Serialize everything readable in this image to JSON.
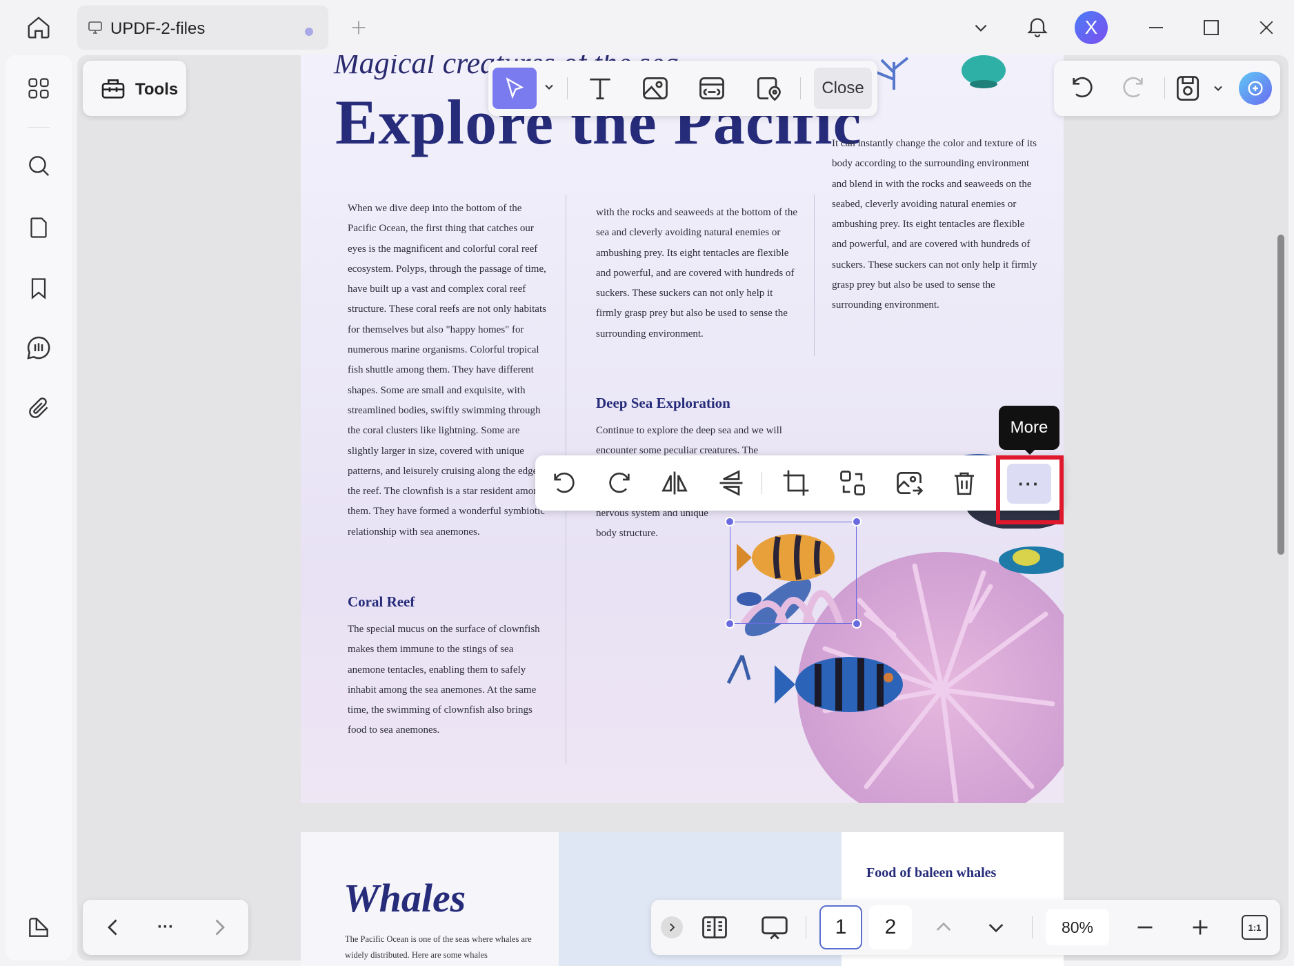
{
  "tab": {
    "title": "UPDF-2-files"
  },
  "user": {
    "avatar_initial": "X"
  },
  "tools": {
    "label": "Tools"
  },
  "edit_toolbar": {
    "close_label": "Close"
  },
  "page": {
    "subtitle": "Magical creatures of the sea",
    "title": "Explore the Pacific",
    "col1_para1": "When we dive deep into the bottom of the Pacific Ocean, the first thing that catches our eyes is the magnificent and colorful coral reef ecosystem. Polyps, through the passage of time, have built up a vast and complex coral reef structure. These coral reefs are not only habitats for themselves but also \"happy homes\" for numerous marine organisms. Colorful tropical fish shuttle among them. They have different shapes. Some are small and exquisite, with streamlined bodies, swiftly swimming through the coral clusters like lightning. Some are slightly larger in size, covered with unique patterns, and leisurely cruising along the edge of the reef. The clownfish is a star resident among them. They have formed a wonderful symbiotic relationship with sea anemones.",
    "coral_heading": "Coral Reef",
    "col1_para2": "The special mucus on the surface of clownfish makes them immune to the stings of sea anemone tentacles, enabling them to safely inhabit among the sea anemones. At the same time, the swimming of clownfish also brings food to sea anemones.",
    "col2_para1": "with the rocks and seaweeds at the bottom of the sea and cleverly avoiding natural enemies or ambushing prey. Its eight tentacles are flexible and powerful, and are covered with hundreds of suckers. These suckers can not only help it firmly grasp prey but also be used to sense the surrounding environment.",
    "deep_heading": "Deep Sea Exploration",
    "col2_para2a": "Continue to explore the deep sea and we will encounter some peculiar creatures. The",
    "col2_para2b": "nervous system and unique body structure.",
    "col3_para1": "It can instantly change the color and texture of its body according to the surrounding environment and blend in with the rocks and seaweeds on the seabed, cleverly avoiding natural enemies or ambushing prey. Its eight tentacles are flexible and powerful, and are covered with hundreds of suckers. These suckers can not only help it firmly grasp prey but also be used to sense the surrounding environment."
  },
  "page2": {
    "title": "Whales",
    "text": "The Pacific Ocean is one of the seas where whales are widely distributed. Here are some whales",
    "food_heading": "Food of baleen whales"
  },
  "tooltip": {
    "text": "More"
  },
  "image_toolbar": {
    "more_glyph": "···"
  },
  "nav": {
    "dots": "···"
  },
  "pagination": {
    "page1": "1",
    "page2": "2",
    "current_page": 1
  },
  "zoom": {
    "level": "80%",
    "fit_label": "1:1"
  },
  "colors": {
    "accent": "#7b7bf0",
    "highlight": "#e0182d",
    "title_navy": "#262b7a"
  }
}
